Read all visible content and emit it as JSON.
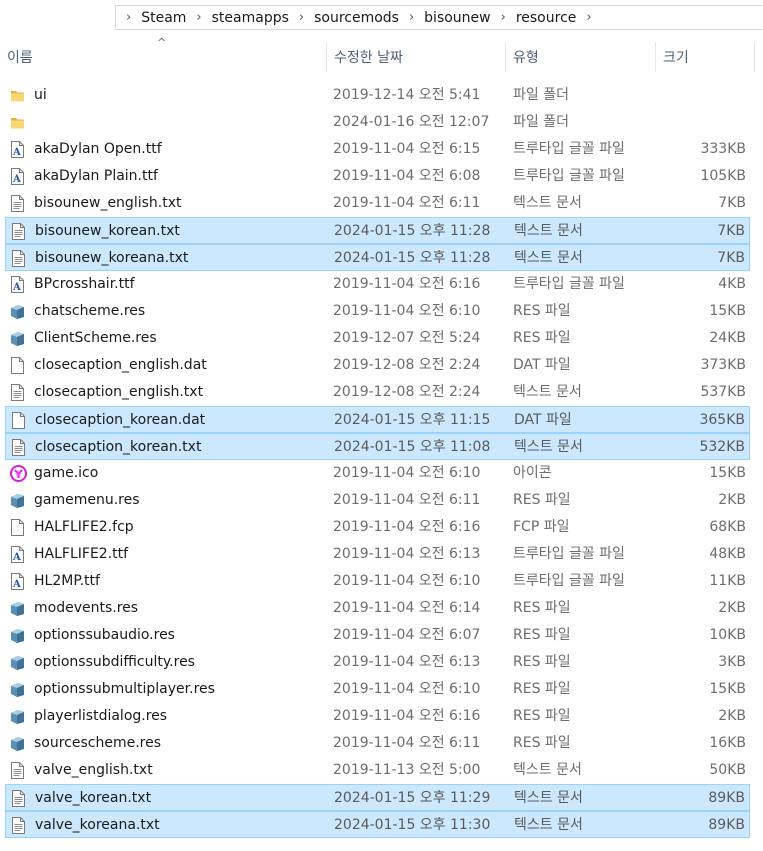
{
  "breadcrumb": [
    "Steam",
    "steamapps",
    "sourcemods",
    "bisounew",
    "resource"
  ],
  "columns": {
    "name": "이름",
    "date": "수정한 날짜",
    "type": "유형",
    "size": "크기"
  },
  "sort_indicator": "^",
  "colors": {
    "selection_bg": "#cce8ff",
    "selection_border": "#99d1ff",
    "folder": "#f3c559"
  },
  "files": [
    {
      "name": "ui",
      "date": "2019-12-14 오전 5:41",
      "type": "파일 폴더",
      "size": "",
      "icon": "folder-icon",
      "selected": false
    },
    {
      "name": "",
      "date": "2024-01-16 오전 12:07",
      "type": "파일 폴더",
      "size": "",
      "icon": "folder-icon",
      "selected": false
    },
    {
      "name": "akaDylan Open.ttf",
      "date": "2019-11-04 오전 6:15",
      "type": "트루타입 글꼴 파일",
      "size": "333KB",
      "icon": "font-file-icon",
      "selected": false
    },
    {
      "name": "akaDylan Plain.ttf",
      "date": "2019-11-04 오전 6:08",
      "type": "트루타입 글꼴 파일",
      "size": "105KB",
      "icon": "font-file-icon",
      "selected": false
    },
    {
      "name": "bisounew_english.txt",
      "date": "2019-11-04 오전 6:11",
      "type": "텍스트 문서",
      "size": "7KB",
      "icon": "text-file-icon",
      "selected": false
    },
    {
      "name": "bisounew_korean.txt",
      "date": "2024-01-15 오후 11:28",
      "type": "텍스트 문서",
      "size": "7KB",
      "icon": "text-file-icon",
      "selected": true
    },
    {
      "name": "bisounew_koreana.txt",
      "date": "2024-01-15 오후 11:28",
      "type": "텍스트 문서",
      "size": "7KB",
      "icon": "text-file-icon",
      "selected": true
    },
    {
      "name": "BPcrosshair.ttf",
      "date": "2019-11-04 오전 6:16",
      "type": "트루타입 글꼴 파일",
      "size": "4KB",
      "icon": "font-file-icon",
      "selected": false
    },
    {
      "name": "chatscheme.res",
      "date": "2019-11-04 오전 6:10",
      "type": "RES 파일",
      "size": "15KB",
      "icon": "res-file-icon",
      "selected": false
    },
    {
      "name": "ClientScheme.res",
      "date": "2019-12-07 오전 5:24",
      "type": "RES 파일",
      "size": "24KB",
      "icon": "res-file-icon",
      "selected": false
    },
    {
      "name": "closecaption_english.dat",
      "date": "2019-12-08 오전 2:24",
      "type": "DAT 파일",
      "size": "373KB",
      "icon": "blank-file-icon",
      "selected": false
    },
    {
      "name": "closecaption_english.txt",
      "date": "2019-12-08 오전 2:24",
      "type": "텍스트 문서",
      "size": "537KB",
      "icon": "text-file-icon",
      "selected": false
    },
    {
      "name": "closecaption_korean.dat",
      "date": "2024-01-15 오후 11:15",
      "type": "DAT 파일",
      "size": "365KB",
      "icon": "blank-file-icon",
      "selected": true
    },
    {
      "name": "closecaption_korean.txt",
      "date": "2024-01-15 오후 11:08",
      "type": "텍스트 문서",
      "size": "532KB",
      "icon": "text-file-icon",
      "selected": true
    },
    {
      "name": "game.ico",
      "date": "2019-11-04 오전 6:10",
      "type": "아이콘",
      "size": "15KB",
      "icon": "game-ico-icon",
      "selected": false
    },
    {
      "name": "gamemenu.res",
      "date": "2019-11-04 오전 6:11",
      "type": "RES 파일",
      "size": "2KB",
      "icon": "res-file-icon",
      "selected": false
    },
    {
      "name": "HALFLIFE2.fcp",
      "date": "2019-11-04 오전 6:16",
      "type": "FCP 파일",
      "size": "68KB",
      "icon": "blank-file-icon",
      "selected": false
    },
    {
      "name": "HALFLIFE2.ttf",
      "date": "2019-11-04 오전 6:13",
      "type": "트루타입 글꼴 파일",
      "size": "48KB",
      "icon": "font-file-icon",
      "selected": false
    },
    {
      "name": "HL2MP.ttf",
      "date": "2019-11-04 오전 6:10",
      "type": "트루타입 글꼴 파일",
      "size": "11KB",
      "icon": "font-file-icon",
      "selected": false
    },
    {
      "name": "modevents.res",
      "date": "2019-11-04 오전 6:14",
      "type": "RES 파일",
      "size": "2KB",
      "icon": "res-file-icon",
      "selected": false
    },
    {
      "name": "optionssubaudio.res",
      "date": "2019-11-04 오전 6:07",
      "type": "RES 파일",
      "size": "10KB",
      "icon": "res-file-icon",
      "selected": false
    },
    {
      "name": "optionssubdifficulty.res",
      "date": "2019-11-04 오전 6:13",
      "type": "RES 파일",
      "size": "3KB",
      "icon": "res-file-icon",
      "selected": false
    },
    {
      "name": "optionssubmultiplayer.res",
      "date": "2019-11-04 오전 6:10",
      "type": "RES 파일",
      "size": "15KB",
      "icon": "res-file-icon",
      "selected": false
    },
    {
      "name": "playerlistdialog.res",
      "date": "2019-11-04 오전 6:16",
      "type": "RES 파일",
      "size": "2KB",
      "icon": "res-file-icon",
      "selected": false
    },
    {
      "name": "sourcescheme.res",
      "date": "2019-11-04 오전 6:11",
      "type": "RES 파일",
      "size": "16KB",
      "icon": "res-file-icon",
      "selected": false
    },
    {
      "name": "valve_english.txt",
      "date": "2019-11-13 오전 5:00",
      "type": "텍스트 문서",
      "size": "50KB",
      "icon": "text-file-icon",
      "selected": false
    },
    {
      "name": "valve_korean.txt",
      "date": "2024-01-15 오후 11:29",
      "type": "텍스트 문서",
      "size": "89KB",
      "icon": "text-file-icon",
      "selected": true
    },
    {
      "name": "valve_koreana.txt",
      "date": "2024-01-15 오후 11:30",
      "type": "텍스트 문서",
      "size": "89KB",
      "icon": "text-file-icon",
      "selected": true
    }
  ]
}
